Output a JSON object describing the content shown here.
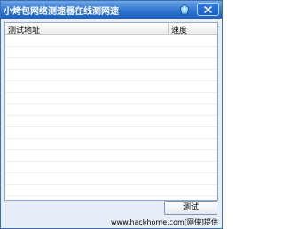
{
  "window": {
    "title": "小烤包网络测速器在线测网速"
  },
  "list": {
    "columns": [
      "测试地址",
      "速度"
    ],
    "rows": []
  },
  "actions": {
    "test_label": "测试"
  },
  "watermark": {
    "text": "www.hackhome.com[网侠]提供"
  },
  "colors": {
    "titlebar": "#2f75d1",
    "window_bg": "#e8eef7",
    "border": "#3b6fb0"
  },
  "icons": {
    "title_icon": "gem-icon",
    "close": "close-icon"
  }
}
